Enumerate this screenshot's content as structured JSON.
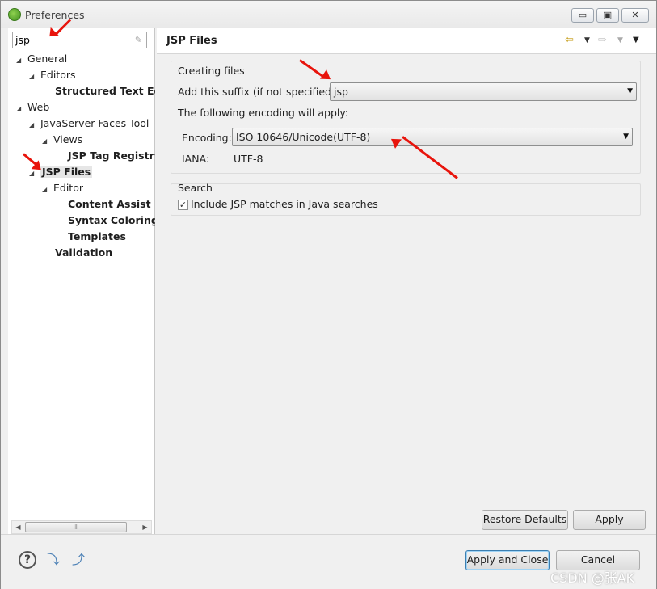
{
  "window": {
    "title": "Preferences",
    "min_label": "▭",
    "max_label": "▣",
    "close_label": "✕"
  },
  "left": {
    "filter_value": "jsp",
    "tree": [
      {
        "label": "General",
        "arrow": "◢",
        "bold": false
      },
      {
        "label": "Editors",
        "arrow": "◢",
        "bold": false
      },
      {
        "label": "Structured Text Ed",
        "arrow": "",
        "bold": true
      },
      {
        "label": "Web",
        "arrow": "◢",
        "bold": false
      },
      {
        "label": "JavaServer Faces Tool",
        "arrow": "◢",
        "bold": false
      },
      {
        "label": "Views",
        "arrow": "◢",
        "bold": false
      },
      {
        "label": "JSP Tag Registry",
        "arrow": "",
        "bold": true
      },
      {
        "label": "JSP Files",
        "arrow": "◢",
        "bold": true
      },
      {
        "label": "Editor",
        "arrow": "◢",
        "bold": false
      },
      {
        "label": "Content Assist",
        "arrow": "",
        "bold": true
      },
      {
        "label": "Syntax Coloring",
        "arrow": "",
        "bold": true
      },
      {
        "label": "Templates",
        "arrow": "",
        "bold": true
      },
      {
        "label": "Validation",
        "arrow": "",
        "bold": true
      }
    ],
    "scroll_thumb": "III"
  },
  "right": {
    "page_title": "JSP Files",
    "creating_group_label": "Creating files",
    "suffix_label": "Add this suffix (if not specified):",
    "suffix_value": "jsp",
    "encoding_intro": "The following encoding will apply:",
    "encoding_label": "Encoding:",
    "encoding_value": "ISO 10646/Unicode(UTF-8)",
    "iana_label": "IANA:",
    "iana_value": "UTF-8",
    "search_group_label": "Search",
    "include_jsp_label": "Include JSP matches in Java searches",
    "include_jsp_checked": true,
    "restore_defaults": "Restore Defaults",
    "apply": "Apply"
  },
  "bottom": {
    "apply_and_close": "Apply and Close",
    "cancel": "Cancel"
  },
  "watermark": "CSDN @张AK",
  "colors": {
    "annotation_arrow": "#e8140c",
    "default_button_border": "#3c7fb1"
  }
}
